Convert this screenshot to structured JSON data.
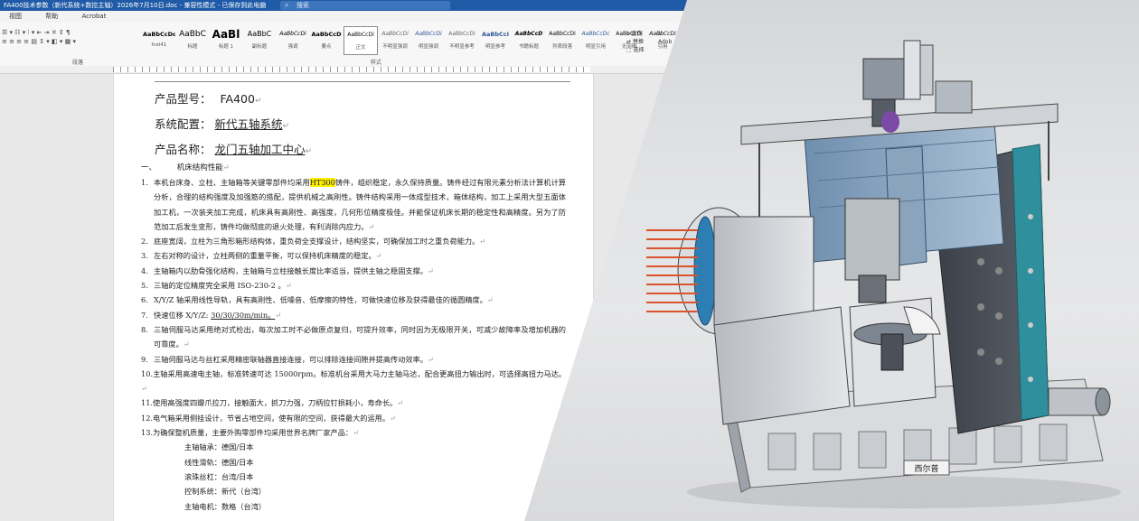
{
  "window": {
    "title": "FA400技术参数（新代系统+数控主轴）2026年7月10日.doc - 兼容性模式 - 已保存到此电脑",
    "search_placeholder": "搜索"
  },
  "menu": [
    "视图",
    "帮助",
    "Acrobat"
  ],
  "ribbon": {
    "styles": [
      {
        "preview": "AaBbCcDd",
        "name": "fcel41"
      },
      {
        "preview": "AaBbC",
        "name": "标题"
      },
      {
        "preview": "AaBl",
        "name": "标题 1"
      },
      {
        "preview": "AaBbC",
        "name": "副标题"
      },
      {
        "preview": "AaBbCcDi",
        "name": "强调"
      },
      {
        "preview": "AaBbCcD",
        "name": "要点"
      },
      {
        "preview": "AaBbCcDi",
        "name": "正文"
      },
      {
        "preview": "AaBbCcDi",
        "name": "不明显强调"
      },
      {
        "preview": "AaBbCcDi",
        "name": "明显强调"
      },
      {
        "preview": "AaBbCcDi",
        "name": "不明显参考"
      },
      {
        "preview": "AaBbCcI",
        "name": "明显参考"
      },
      {
        "preview": "AaBbCcD",
        "name": "书籍标题"
      },
      {
        "preview": "AaBbCcDi",
        "name": "列表段落"
      },
      {
        "preview": "AaBbCcDc",
        "name": "明显引用"
      },
      {
        "preview": "AaBbCcDi",
        "name": "无间隔"
      },
      {
        "preview": "AaBbCcDi",
        "name": "引用"
      }
    ],
    "group_paragraph": "段落",
    "group_styles": "样式",
    "right_find": "查找",
    "right_replace": "替换",
    "right_select": "选择",
    "right_adobe": "Adob"
  },
  "document": {
    "model_label": "产品型号：",
    "model_value": "FA400",
    "config_label": "系统配置：",
    "config_value": "新代五轴系统",
    "name_label": "产品名称：",
    "name_value": "龙门五轴加工中心",
    "section_no": "一、",
    "section_title": "机床结构性能",
    "items": [
      {
        "no": "1.",
        "pre": "本机台床身、立柱、主轴箱等关键零部件均采用",
        "mark": "HT300",
        "post": "铸件，组织稳定，永久保持质量。铸件经过有限元素分析法计算机计算分析，合理的结构强度及加强筋的搭配，提供机械之高刚性。铸件结构采用一体成型技术，箱体结构，加工上采用大型五面体加工机，一次装夹加工完成，机床具有高刚性、高强度，几何形位精度极佳。并能保证机床长期的稳定性和高精度。另为了防范加工后发生变形，铸件均做彻底的退火处理，有利消除内应力。"
      },
      {
        "no": "2.",
        "pre": "底座宽阔，立柱为三角形箱形结构体，重负荷全支撑设计，结构坚实，可确保加工时之重负荷能力。",
        "mark": "",
        "post": ""
      },
      {
        "no": "3.",
        "pre": "左右对称的设计，立柱两侧的重量平衡，可以保持机床精度的稳定。",
        "mark": "",
        "post": ""
      },
      {
        "no": "4.",
        "pre": "主轴箱内以肋骨强化结构，主轴箱与立柱接触长度比率适当，提供主轴之稳固支撑。",
        "mark": "",
        "post": ""
      },
      {
        "no": "5.",
        "pre": "三轴的定位精度完全采用 ISO-230-2 。",
        "mark": "",
        "post": ""
      },
      {
        "no": "6.",
        "pre": "X/Y/Z 轴采用线性导轨，具有高刚性、低噪音、低摩擦的特性，可做快速位移及获得最佳的循圆精度。",
        "mark": "",
        "post": ""
      },
      {
        "no": "7.",
        "pre": "快速位移 X/Y/Z: ",
        "mark": "",
        "post": "30/30/30m/min。"
      },
      {
        "no": "8.",
        "pre": "三轴伺服马达采用绝对式检出，每次加工时不必做原点复归，可提升效率，同时因为无极限开关，可减少故障率及增加机器的可靠度。",
        "mark": "",
        "post": ""
      },
      {
        "no": "9.",
        "pre": "三轴伺服马达与丝杠采用精密联轴器直接连接，可以排除连接间隙并提高传动效率。",
        "mark": "",
        "post": ""
      },
      {
        "no": "10.",
        "pre": "主轴采用高速电主轴，标准转速可达 15000rpm。标准机台采用大马力主轴马达，配合更高扭力输出时，可选择高扭力马达。",
        "mark": "",
        "post": ""
      },
      {
        "no": "11.",
        "pre": "使用高强度四瓣爪拉刀，接触面大，抓刀力强，刀柄拉钉损耗小，寿命长。",
        "mark": "",
        "post": ""
      },
      {
        "no": "12.",
        "pre": "电气箱采用侧挂设计，节省占地空间，使有限的空间，获得最大的运用。",
        "mark": "",
        "post": ""
      },
      {
        "no": "13.",
        "pre": "为确保整机质量，主要外购零部件均采用世界名牌厂家产品：",
        "mark": "",
        "post": ""
      }
    ],
    "brands": [
      "主轴轴承：德国/日本",
      "线性滑轨：德国/日本",
      "滚珠丝杠：台湾/日本",
      "控制系统：新代（台湾）",
      "主轴电机：数格（台湾）"
    ]
  },
  "machine": {
    "nameplate": "西尔普"
  }
}
